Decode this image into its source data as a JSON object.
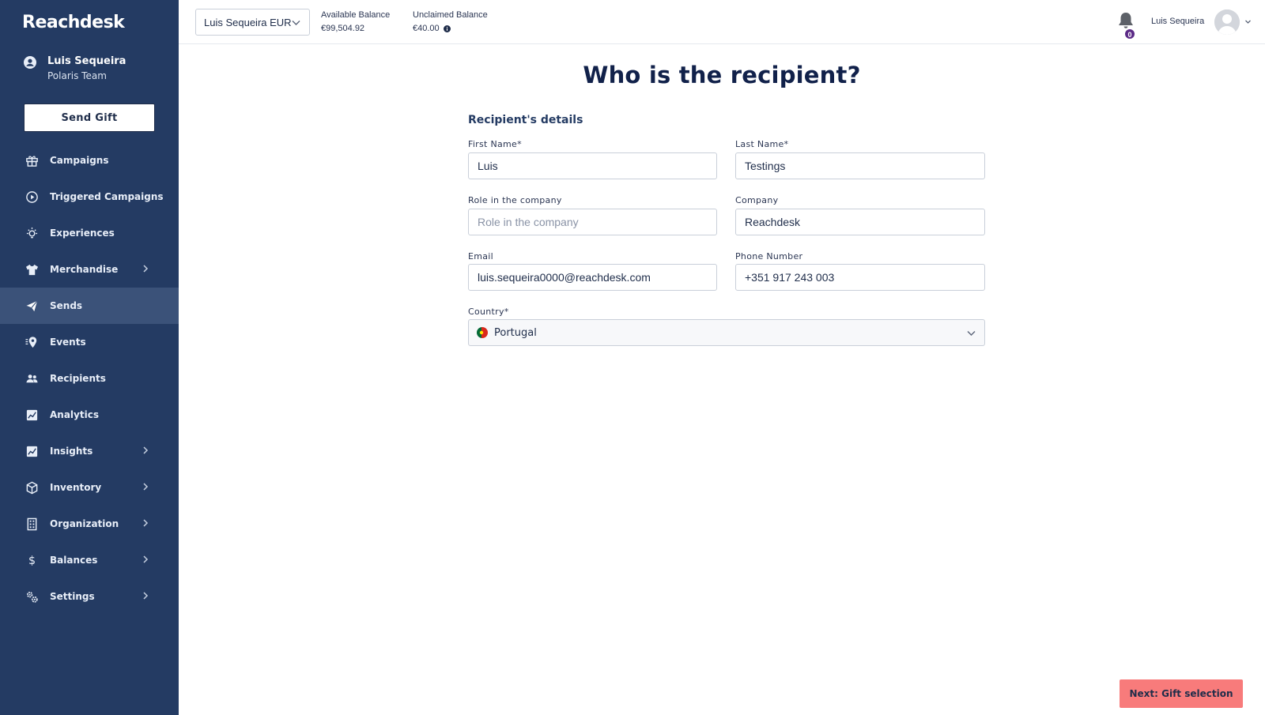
{
  "sidebar": {
    "logo": "Reachdesk",
    "user_name": "Luis Sequeira",
    "user_team": "Polaris Team",
    "send_gift_label": "Send Gift",
    "items": [
      {
        "label": "Campaigns",
        "icon": "gift-icon"
      },
      {
        "label": "Triggered Campaigns",
        "icon": "play-circle-icon"
      },
      {
        "label": "Experiences",
        "icon": "lightbulb-icon"
      },
      {
        "label": "Merchandise",
        "icon": "tshirt-icon"
      },
      {
        "label": "Sends",
        "icon": "paper-plane-icon"
      },
      {
        "label": "Events",
        "icon": "location-pin-icon"
      },
      {
        "label": "Recipients",
        "icon": "users-icon"
      },
      {
        "label": "Analytics",
        "icon": "chart-icon"
      },
      {
        "label": "Insights",
        "icon": "insights-icon"
      },
      {
        "label": "Inventory",
        "icon": "box-icon"
      },
      {
        "label": "Organization",
        "icon": "building-icon"
      },
      {
        "label": "Balances",
        "icon": "dollar-icon"
      },
      {
        "label": "Settings",
        "icon": "gears-icon"
      }
    ]
  },
  "topbar": {
    "account": "Luis Sequeira EUR",
    "available_label": "Available Balance",
    "available_value": "€99,504.92",
    "unclaimed_label": "Unclaimed Balance",
    "unclaimed_value": "€40.00",
    "notification_count": "0",
    "user_name": "Luis Sequeira"
  },
  "form": {
    "title": "Who is the recipient?",
    "section_title": "Recipient's details",
    "first_name_label": "First Name*",
    "first_name_value": "Luis",
    "last_name_label": "Last Name*",
    "last_name_value": "Testings",
    "role_label": "Role in the company",
    "role_placeholder": "Role in the company",
    "company_label": "Company",
    "company_value": "Reachdesk",
    "email_label": "Email",
    "email_value": "luis.sequeira0000@reachdesk.com",
    "phone_label": "Phone Number",
    "phone_value": "+351 917 243 003",
    "country_label": "Country*",
    "country_value": "Portugal"
  },
  "footer": {
    "next_label": "Next: Gift selection"
  },
  "colors": {
    "sidebar_bg": "#243b63",
    "sidebar_active": "#3b5279",
    "title": "#11214a",
    "next_button": "#f87b7b",
    "badge": "#5b2a86"
  }
}
